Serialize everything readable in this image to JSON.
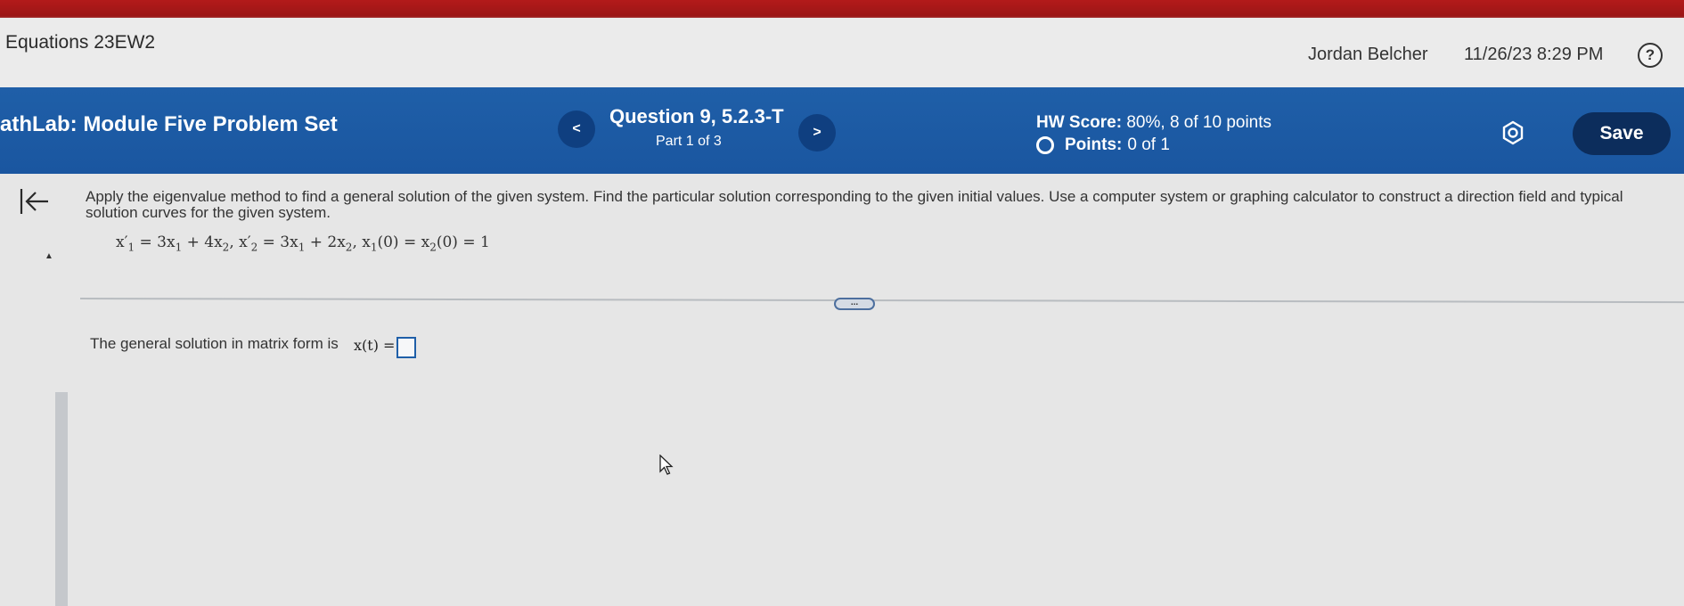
{
  "header": {
    "course_title": "Equations 23EW2",
    "user_name": "Jordan Belcher",
    "timestamp": "11/26/23 8:29 PM",
    "help_icon": "question-circle-icon",
    "help_label": "?"
  },
  "toolbar": {
    "assignment_title": "athLab: Module Five Problem Set",
    "prev_label": "<",
    "next_label": ">",
    "question_title": "Question 9, 5.2.3-T",
    "part_label": "Part 1 of 3",
    "hw_score_prefix": "HW Score:",
    "hw_score_value": "80%, 8 of 10 points",
    "points_prefix": "Points:",
    "points_value": "0 of 1",
    "settings_icon": "gear-icon",
    "save_label": "Save"
  },
  "question": {
    "back_icon": "back-to-start-icon",
    "prompt": "Apply the eigenvalue method to find a general solution of the given system. Find the particular solution corresponding to the given initial values. Use a computer system or graphing calculator to construct a direction field and typical solution curves for the given system.",
    "equation": {
      "eq1_lhs": "x′",
      "eq1_lhs_sub": "1",
      "eq1_rhs_a": "= 3x",
      "eq1_rhs_a_sub": "1",
      "eq1_rhs_b": " + 4x",
      "eq1_rhs_b_sub": "2",
      "sep1": ", ",
      "eq2_lhs": "x′",
      "eq2_lhs_sub": "2",
      "eq2_rhs_a": "= 3x",
      "eq2_rhs_a_sub": "1",
      "eq2_rhs_b": " + 2x",
      "eq2_rhs_b_sub": "2",
      "sep2": ", ",
      "init_a": "x",
      "init_a_sub": "1",
      "init_b": "(0) = x",
      "init_b_sub": "2",
      "init_c": "(0) = 1"
    },
    "more_label": "...",
    "answer_label": "The general solution in matrix form is",
    "answer_expr": "x(t) ="
  }
}
